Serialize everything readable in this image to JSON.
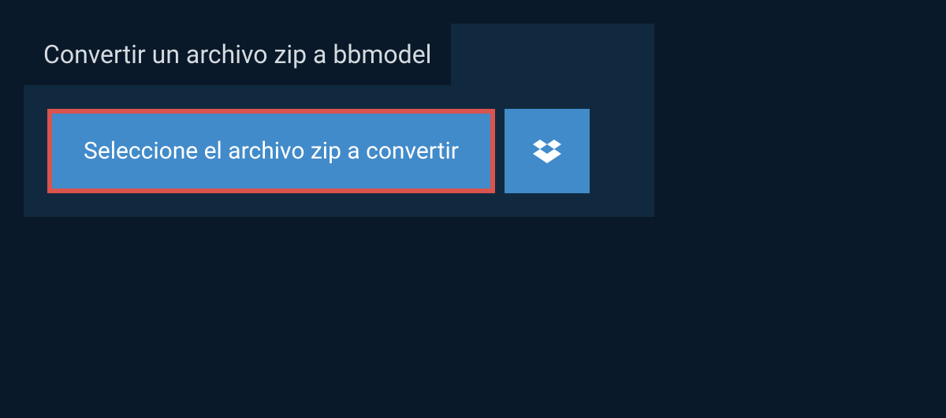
{
  "header": {
    "title": "Convertir un archivo zip a bbmodel"
  },
  "actions": {
    "select_file_label": "Seleccione el archivo zip a convertir"
  },
  "colors": {
    "background": "#0a1929",
    "panel": "#11293e",
    "button": "#428bca",
    "highlight_border": "#d9534f"
  }
}
